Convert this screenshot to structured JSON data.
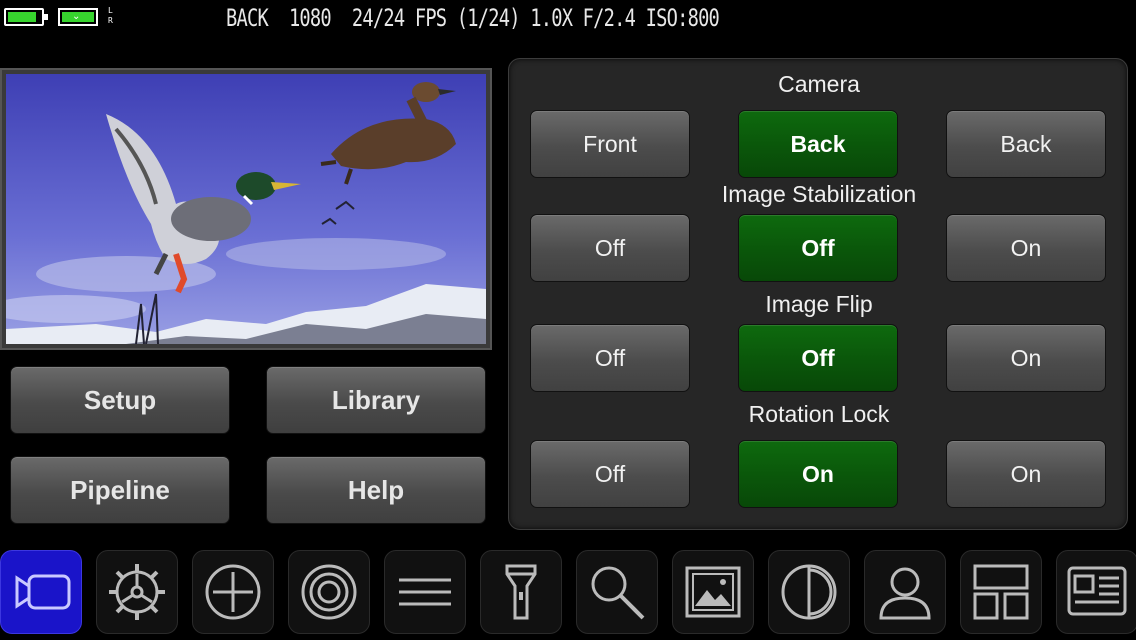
{
  "status": {
    "text": "BACK  1080  24/24 FPS (1/24) 1.0X F/2.4 ISO:800",
    "audio_channels": [
      "L",
      "R"
    ],
    "battery_color": "#37d42e"
  },
  "menu": {
    "setup": "Setup",
    "library": "Library",
    "pipeline": "Pipeline",
    "help": "Help"
  },
  "settings": {
    "camera": {
      "title": "Camera",
      "left": "Front",
      "current": "Back",
      "right": "Back"
    },
    "stabilization": {
      "title": "Image Stabilization",
      "left": "Off",
      "current": "Off",
      "right": "On"
    },
    "flip": {
      "title": "Image Flip",
      "left": "Off",
      "current": "Off",
      "right": "On"
    },
    "rotation": {
      "title": "Rotation Lock",
      "left": "Off",
      "current": "On",
      "right": "On"
    }
  },
  "colors": {
    "active_green": "#0b5e0b",
    "active_tool": "#1a14c9"
  },
  "toolbar": {
    "icons": [
      "video-camera-icon",
      "gear-icon",
      "crosshair-icon",
      "target-icon",
      "menu-lines-icon",
      "flashlight-icon",
      "search-icon",
      "image-icon",
      "contrast-icon",
      "person-icon",
      "layout-icon",
      "news-icon"
    ]
  }
}
